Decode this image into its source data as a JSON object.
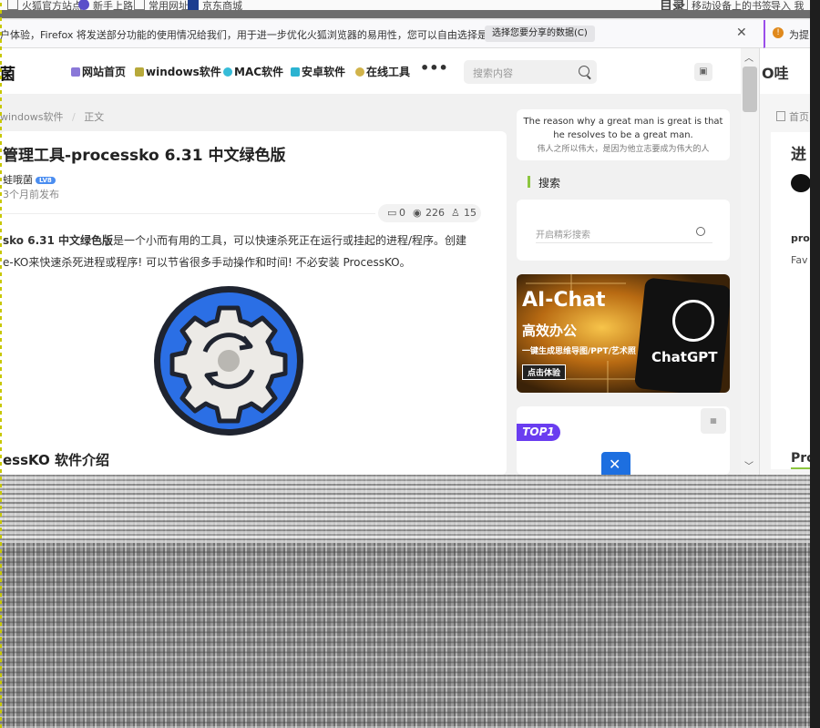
{
  "bookmarks": [
    "火狐官方站点",
    "新手上路",
    "常用网址",
    "京东商城"
  ],
  "right_toolbar": {
    "title": "目录",
    "link": "移动设备上的书签",
    "mini": "导入 我"
  },
  "notification": {
    "text": "户体验，Firefox 将发送部分功能的使用情况给我们，用于进一步优化火狐浏览器的易用性，您可以自由选择是否向我们分享数据。",
    "button": "选择您要分享的数据(C)",
    "close": "✕",
    "right_text": "为提"
  },
  "header": {
    "logo": "菌",
    "nav": [
      {
        "label": "网站首页",
        "color": "#8a78d8"
      },
      {
        "label": "windows软件",
        "color": "#b7a93a"
      },
      {
        "label": "MAC软件",
        "color": "#36bcd8"
      },
      {
        "label": "安卓软件",
        "color": "#2bb3d1"
      },
      {
        "label": "在线工具",
        "color": "#d1b34a"
      }
    ],
    "more": "•••",
    "search_placeholder": "搜索内容"
  },
  "breadcrumb": {
    "parent": "windows软件",
    "sep": "/",
    "current": "正文"
  },
  "article": {
    "title": "管理工具-processko 6.31 中文绿色版",
    "author": "蛙哦菌",
    "level": "LV8",
    "time": "3个月前发布",
    "stats": {
      "comments": "0",
      "views": "226",
      "likes": "15"
    },
    "para1_bold": "sko 6.31 中文绿色版",
    "para1_rest": "是一个小而有用的工具，可以快速杀死正在运行或挂起的进程/程序。创建",
    "para2": "e-KO来快速杀死进程或程序! 可以节省很多手动操作和时间! 不必安装 ProcessKO。",
    "section": "essKO 软件介绍"
  },
  "sidebar": {
    "quote_en_1": "The reason why a great man is great is that",
    "quote_en_2": "he resolves to be a great man.",
    "quote_zh": "伟人之所以伟大，是因为他立志要成为伟大的人",
    "search_heading": "搜索",
    "search_placeholder": "开启精彩搜索",
    "ad": {
      "title": "AI-Chat",
      "subtitle": "高效办公",
      "desc": "一键生成思维导图/PPT/艺术照",
      "button": "点击体验",
      "brand": "ChatGPT"
    },
    "top_badge": "TOP1"
  },
  "right_window": {
    "breadcrumb": "首页",
    "title_char": "进",
    "items": [
      "proc",
      "Fav",
      "Pro"
    ]
  },
  "colors": {
    "accent_green": "#8cc63f",
    "badge_purple": "#6a3df0",
    "gear_blue": "#2b6fe5"
  }
}
